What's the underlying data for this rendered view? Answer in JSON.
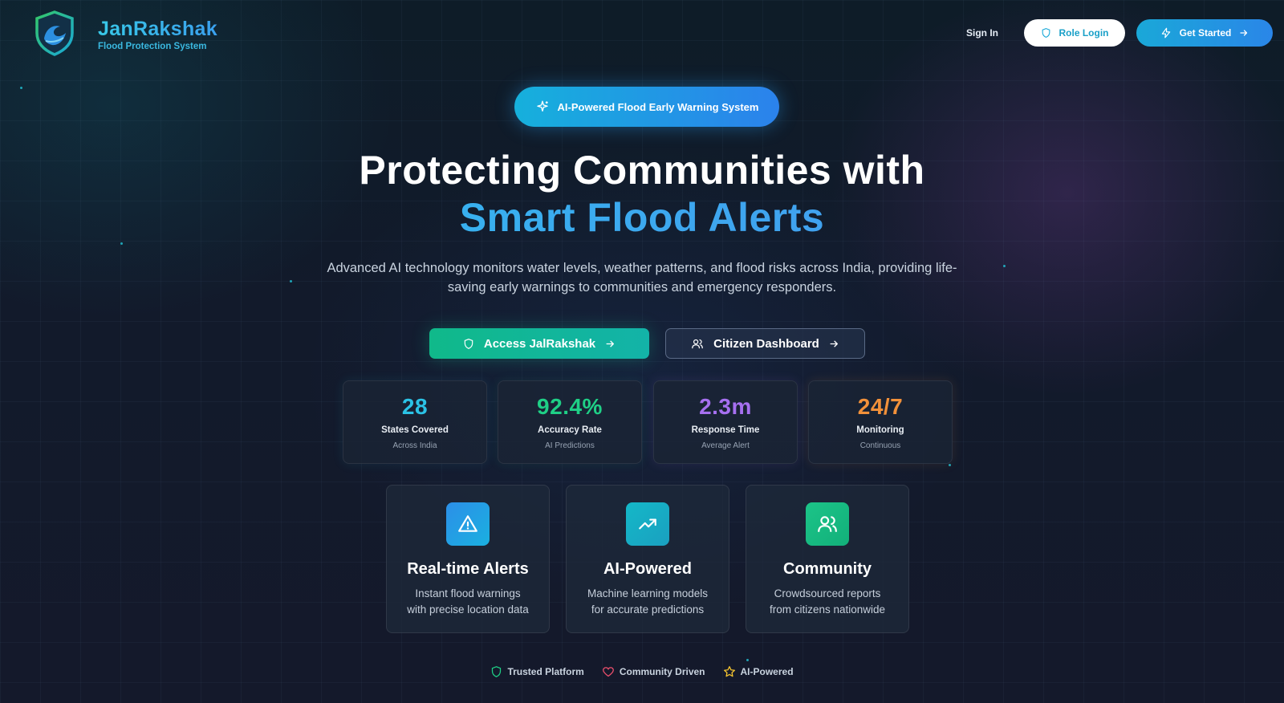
{
  "brand": {
    "name": "JanRakshak",
    "subtitle": "Flood Protection System"
  },
  "nav": {
    "sign_in": "Sign In",
    "role_login": "Role Login",
    "get_started": "Get Started"
  },
  "hero": {
    "pill": "AI-Powered Flood Early Warning System",
    "headline_1": "Protecting Communities with",
    "headline_2": "Smart Flood Alerts",
    "description": "Advanced AI technology monitors water levels, weather patterns, and flood risks across India, providing life-saving early warnings to communities and emergency responders.",
    "cta_primary": "Access JalRakshak",
    "cta_secondary": "Citizen Dashboard"
  },
  "stats": [
    {
      "value": "28",
      "label": "States Covered",
      "sub": "Across India",
      "color": "#2bc3e6"
    },
    {
      "value": "92.4%",
      "label": "Accuracy Rate",
      "sub": "AI Predictions",
      "color": "#1fcf86"
    },
    {
      "value": "2.3m",
      "label": "Response Time",
      "sub": "Average Alert",
      "color": "#a670f0"
    },
    {
      "value": "24/7",
      "label": "Monitoring",
      "sub": "Continuous",
      "color": "#f2913a"
    }
  ],
  "features": [
    {
      "title": "Real-time Alerts",
      "desc_1": "Instant flood warnings",
      "desc_2": "with precise location data",
      "icon": "alert-triangle-icon"
    },
    {
      "title": "AI-Powered",
      "desc_1": "Machine learning models",
      "desc_2": "for accurate predictions",
      "icon": "trending-up-icon"
    },
    {
      "title": "Community",
      "desc_1": "Crowdsourced reports",
      "desc_2": "from citizens nationwide",
      "icon": "users-icon"
    }
  ],
  "badges": [
    {
      "label": "Trusted Platform",
      "icon": "shield-icon",
      "color": "#1fcf86"
    },
    {
      "label": "Community Driven",
      "icon": "heart-icon",
      "color": "#f0506e"
    },
    {
      "label": "AI-Powered",
      "icon": "star-icon",
      "color": "#f2c230"
    }
  ],
  "colors": {
    "accent": "#1aa8d8",
    "primary_cta": "#10b98a"
  }
}
